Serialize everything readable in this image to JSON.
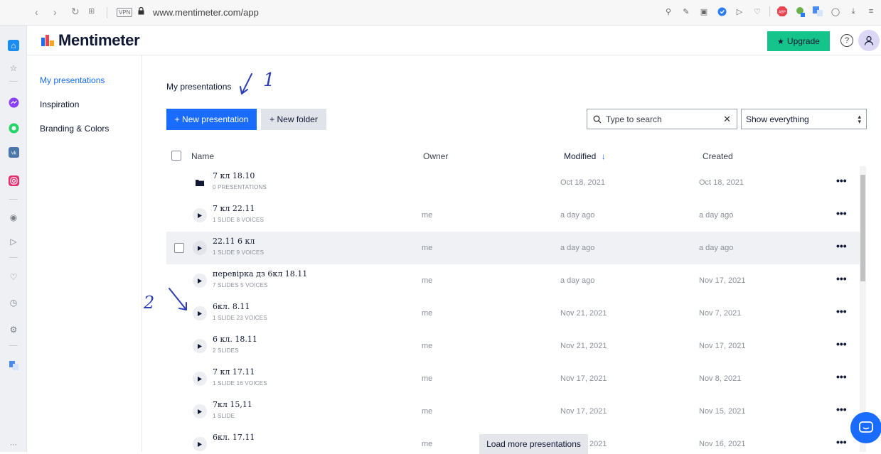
{
  "browser": {
    "url": "www.mentimeter.com/app",
    "vpn_label": "VPN"
  },
  "app": {
    "brand": "Mentimeter",
    "upgrade_label": "Upgrade",
    "help_label": "?",
    "accent": "#196cff",
    "upgrade_color": "#14c48b"
  },
  "nav": {
    "items": [
      {
        "label": "My presentations",
        "active": true
      },
      {
        "label": "Inspiration",
        "active": false
      },
      {
        "label": "Branding & Colors",
        "active": false
      }
    ]
  },
  "main": {
    "title": "My presentations",
    "new_presentation_label": "+ New presentation",
    "new_folder_label": "+ New folder",
    "search_placeholder": "Type to search",
    "filter_value": "Show everything",
    "load_more_label": "Load more presentations"
  },
  "table": {
    "headers": {
      "name": "Name",
      "owner": "Owner",
      "modified": "Modified",
      "created": "Created"
    },
    "rows": [
      {
        "title": "7 кл 18.10",
        "meta": "0 PRESENTATIONS",
        "owner": "",
        "modified": "Oct 18, 2021",
        "created": "Oct 18, 2021",
        "type": "folder"
      },
      {
        "title": "7 кл 22.11",
        "meta": "1 SLIDE  8 VOICES",
        "owner": "me",
        "modified": "a day ago",
        "created": "a day ago",
        "type": "presentation"
      },
      {
        "title": "22.11 6 кл",
        "meta": "1 SLIDE  9 VOICES",
        "owner": "me",
        "modified": "a day ago",
        "created": "a day ago",
        "type": "presentation"
      },
      {
        "title": "перевірка дз 6кл 18.11",
        "meta": "7 SLIDES  5 VOICES",
        "owner": "me",
        "modified": "a day ago",
        "created": "Nov 17, 2021",
        "type": "presentation"
      },
      {
        "title": "6кл. 8.11",
        "meta": "1 SLIDE  23 VOICES",
        "owner": "me",
        "modified": "Nov 21, 2021",
        "created": "Nov 7, 2021",
        "type": "presentation"
      },
      {
        "title": "6 кл. 18.11",
        "meta": "2 SLIDES",
        "owner": "me",
        "modified": "Nov 21, 2021",
        "created": "Nov 17, 2021",
        "type": "presentation"
      },
      {
        "title": "7 кл 17.11",
        "meta": "1 SLIDE  16 VOICES",
        "owner": "me",
        "modified": "Nov 17, 2021",
        "created": "Nov 8, 2021",
        "type": "presentation"
      },
      {
        "title": "7кл 15,11",
        "meta": "1 SLIDE",
        "owner": "me",
        "modified": "Nov 17, 2021",
        "created": "Nov 15, 2021",
        "type": "presentation"
      },
      {
        "title": "6кл. 17.11",
        "meta": "",
        "owner": "me",
        "modified": "Nov 16, 2021",
        "created": "Nov 16, 2021",
        "type": "presentation"
      }
    ]
  },
  "annotations": {
    "mark1": "1",
    "mark2": "2"
  }
}
